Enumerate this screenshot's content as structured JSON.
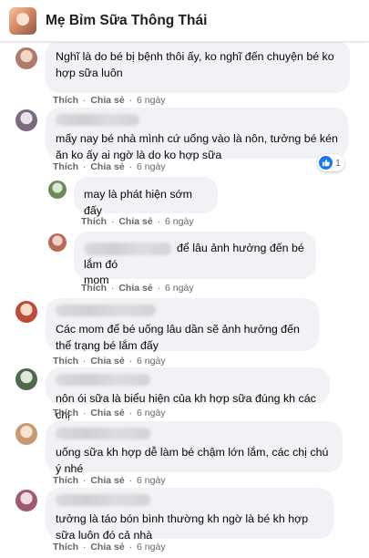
{
  "header": {
    "title": "Mẹ Bỉm Sữa Thông Thái"
  },
  "colors": {
    "accent": "#1877f2",
    "bubble": "#f0f2f5",
    "meta": "#65676b"
  },
  "actions": {
    "like": "Thích",
    "share": "Chia sẻ",
    "dot": "·"
  },
  "comments": [
    {
      "text": "Nghĩ là do bé bị bệnh thôi ấy, ko nghĩ đến chuyện bé ko hợp sữa luôn",
      "time": "6 ngày"
    },
    {
      "text": "mấy nay bé nhà mình cứ uống vào là nôn, tưởng bé kén ăn ko ấy ai ngờ là do ko hợp sữa",
      "time": "6 ngày",
      "reaction_count": "1",
      "reaction_icon": "like-icon"
    },
    {
      "text": "may là phát hiện sớm đấy",
      "time": "6 ngày"
    },
    {
      "text_inline": "để lâu ảnh hưởng đến bé lắm đó",
      "text_rest": "mom",
      "time": "6 ngày"
    },
    {
      "text": "Các mom để bé uống lâu dần sẽ ảnh hưởng đến thể trạng bé lắm đấy",
      "time": "6 ngày"
    },
    {
      "text": "nôn ói sữa là biểu hiện của kh hợp sữa đúng kh các chị",
      "time": "6 ngày"
    },
    {
      "text": "uống sữa kh hợp dễ làm bé chậm lớn lắm, các chị chú ý nhé",
      "time": "6 ngày"
    },
    {
      "text": "tưởng là táo bón bình thường kh ngờ là bé kh hợp sữa luôn đó cả nhà",
      "time": "6 ngày"
    }
  ]
}
